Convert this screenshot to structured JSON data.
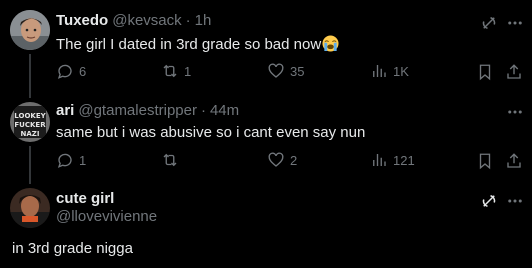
{
  "tweets": [
    {
      "name": "Tuxedo",
      "handle": "@kevsack",
      "time": "1h",
      "text": "The girl I dated in 3rd grade so bad now",
      "emoji": "loudly-crying-face",
      "replies": "6",
      "reposts": "1",
      "likes": "35",
      "views": "1K"
    },
    {
      "name": "ari",
      "handle": "@gtamalestripper",
      "time": "44m",
      "text": "same but i was abusive so i cant even say nun",
      "replies": "1",
      "reposts": "",
      "likes": "2",
      "views": "121"
    },
    {
      "name": "cute girl",
      "handle": "@llovevivienne",
      "text": "in 3rd grade nigga"
    }
  ],
  "colors": {
    "background": "#000000",
    "text": "#e7e9ea",
    "muted": "#71767b",
    "thread_line": "#333639"
  },
  "icons": [
    "reply-icon",
    "repost-icon",
    "like-icon",
    "views-icon",
    "bookmark-icon",
    "share-icon",
    "grok-icon",
    "more-icon"
  ]
}
